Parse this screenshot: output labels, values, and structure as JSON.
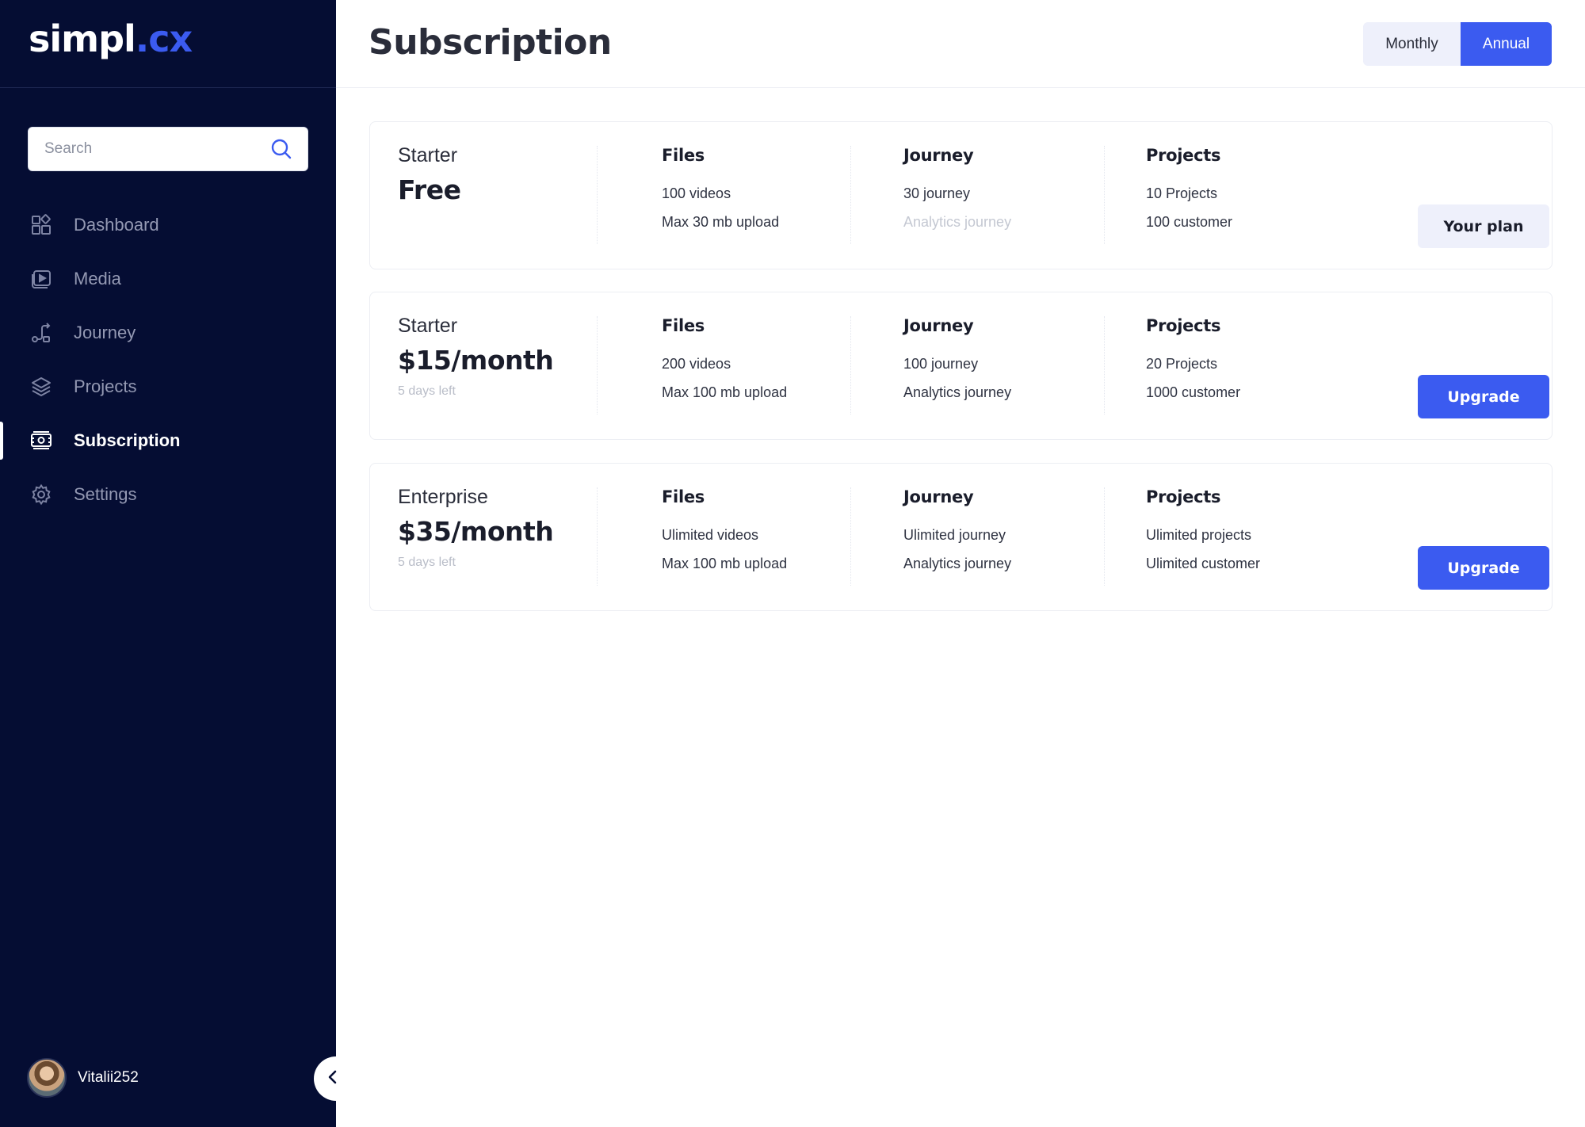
{
  "brand": {
    "name_part1": "simpl",
    "name_part2": ".cx",
    "accent": "#3b5bf0",
    "sidebar_bg": "#050d33"
  },
  "search": {
    "placeholder": "Search"
  },
  "nav": [
    {
      "label": "Dashboard",
      "icon": "dashboard-icon",
      "active": false
    },
    {
      "label": "Media",
      "icon": "media-icon",
      "active": false
    },
    {
      "label": "Journey",
      "icon": "journey-icon",
      "active": false
    },
    {
      "label": "Projects",
      "icon": "layers-icon",
      "active": false
    },
    {
      "label": "Subscription",
      "icon": "money-icon",
      "active": true
    },
    {
      "label": "Settings",
      "icon": "gear-icon",
      "active": false
    }
  ],
  "user": {
    "name": "Vitalii252"
  },
  "page": {
    "title": "Subscription"
  },
  "billing_toggle": {
    "monthly": "Monthly",
    "annual": "Annual",
    "selected": "Annual"
  },
  "plans": [
    {
      "tier": "Starter",
      "price": "Free",
      "days_left": "",
      "files": {
        "head": "Files",
        "line1": "100 videos",
        "line2": "Max 30 mb upload"
      },
      "journey": {
        "head": "Journey",
        "line1": "30  journey",
        "line2": "Analytics journey",
        "line2_disabled": true
      },
      "projects": {
        "head": "Projects",
        "line1": "10 Projects",
        "line2": "100 customer"
      },
      "button": "Your plan",
      "current": true
    },
    {
      "tier": "Starter",
      "price": "$15/month",
      "days_left": "5 days left",
      "files": {
        "head": "Files",
        "line1": "200 videos",
        "line2": "Max 100 mb upload"
      },
      "journey": {
        "head": "Journey",
        "line1": "100  journey",
        "line2": "Analytics journey",
        "line2_disabled": false
      },
      "projects": {
        "head": "Projects",
        "line1": "20 Projects",
        "line2": "1000 customer"
      },
      "button": "Upgrade",
      "current": false
    },
    {
      "tier": "Enterprise",
      "price": "$35/month",
      "days_left": "5 days left",
      "files": {
        "head": "Files",
        "line1": "Ulimited videos",
        "line2": "Max 100 mb upload"
      },
      "journey": {
        "head": "Journey",
        "line1": "Ulimited journey",
        "line2": "Analytics journey",
        "line2_disabled": false
      },
      "projects": {
        "head": "Projects",
        "line1": "Ulimited projects",
        "line2": "Ulimited customer"
      },
      "button": "Upgrade",
      "current": false
    }
  ]
}
